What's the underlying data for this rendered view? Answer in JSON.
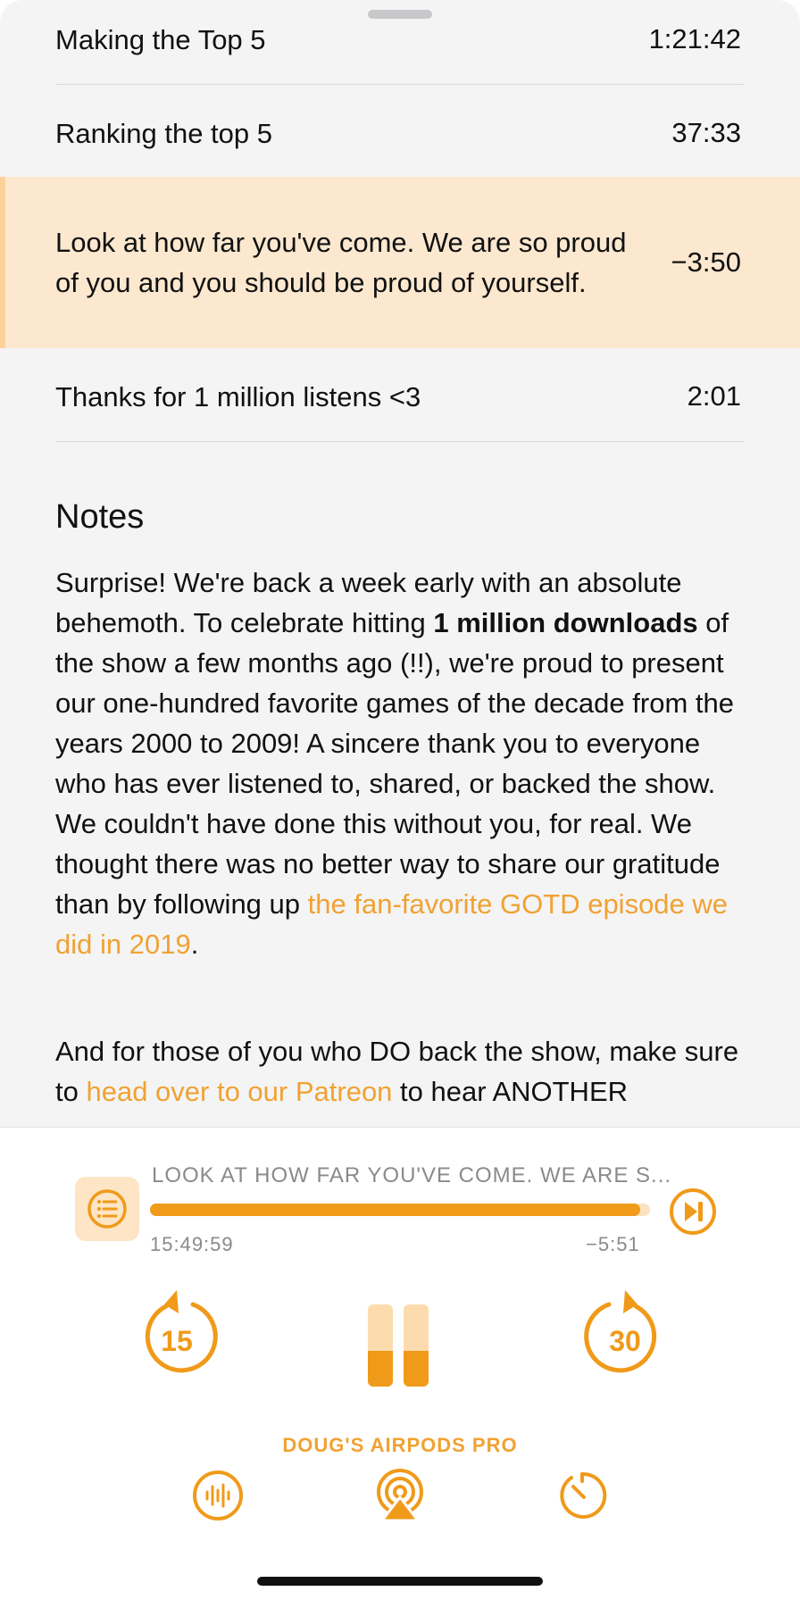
{
  "chapters": [
    {
      "title": "Making the Top 5",
      "time": "1:21:42"
    },
    {
      "title": "Ranking the top 5",
      "time": "37:33"
    },
    {
      "title": "Look at how far you've come. We are so proud of you and you should be proud of yourself.",
      "time": "−3:50",
      "current": true
    },
    {
      "title": "Thanks for 1 million listens <3",
      "time": "2:01"
    }
  ],
  "notes": {
    "heading": "Notes",
    "p1_a": "Surprise! We're back a week early with an absolute behemoth. To celebrate hitting ",
    "p1_bold": "1 million downloads",
    "p1_b": " of the show a few months ago (!!), we're proud to present our one-hundred favorite games of the decade from the years 2000 to 2009! A sincere thank you to everyone who has ever listened to, shared, or backed the show. We couldn't have done this without you, for real. We thought there was no better way to share our gratitude than by following up ",
    "p1_link": "the fan-favorite GOTD episode we did in 2019",
    "p1_c": ".",
    "p2_a": "And for those of you who DO back the show, make sure to ",
    "p2_link": "head over to our Patreon",
    "p2_b": " to hear ANOTHER"
  },
  "player": {
    "now_playing_title": "LOOK AT HOW FAR YOU'VE COME. WE ARE S...",
    "elapsed": "15:49:59",
    "remaining": "−5:51",
    "progress": 0.98,
    "skip_back_seconds": "15",
    "skip_forward_seconds": "30",
    "output_device": "DOUG'S AIRPODS PRO"
  },
  "colors": {
    "accent": "#f09a1a",
    "accent_light": "#fde5c6",
    "current_chapter_bg": "#fbe8cf"
  },
  "icons": [
    "queue-list-icon",
    "skip-to-next-chapter-icon",
    "skip-back-15-icon",
    "pause-icon",
    "skip-forward-30-icon",
    "audio-effects-icon",
    "airplay-icon",
    "sleep-timer-icon"
  ]
}
